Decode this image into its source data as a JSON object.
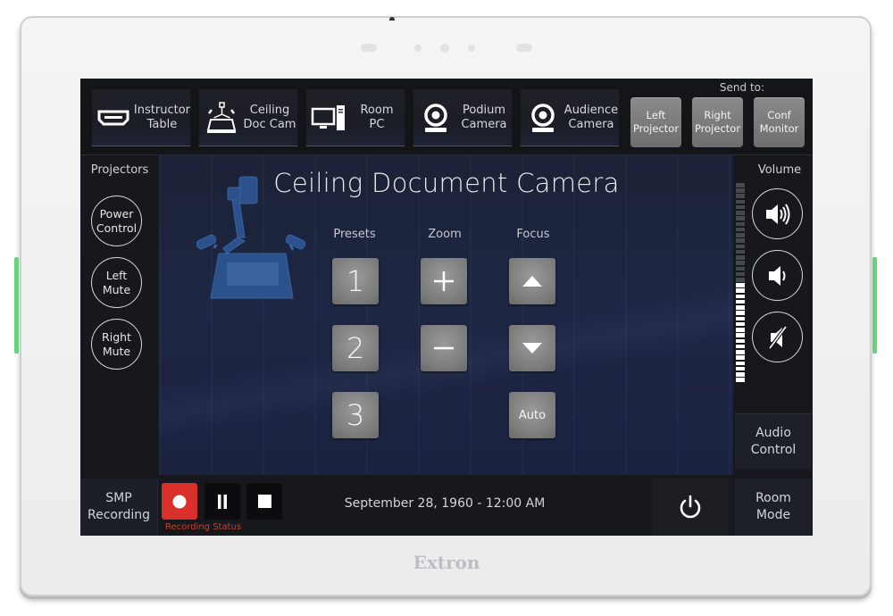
{
  "device": {
    "brand": "Extron",
    "indicator_color": "#64d37a"
  },
  "sources": [
    {
      "label": "Instructor\nTable",
      "icon": "hdmi-icon"
    },
    {
      "label": "Ceiling\nDoc Cam",
      "icon": "document-camera-icon"
    },
    {
      "label": "Room\nPC",
      "icon": "desktop-pc-icon"
    },
    {
      "label": "Podium\nCamera",
      "icon": "webcam-icon"
    },
    {
      "label": "Audience\nCamera",
      "icon": "webcam-icon"
    }
  ],
  "send_to": {
    "label": "Send to:",
    "destinations": [
      {
        "label": "Left\nProjector"
      },
      {
        "label": "Right\nProjector"
      },
      {
        "label": "Conf\nMonitor"
      }
    ]
  },
  "projectors": {
    "title": "Projectors",
    "buttons": [
      {
        "label": "Power\nControl"
      },
      {
        "label": "Left\nMute"
      },
      {
        "label": "Right\nMute"
      }
    ]
  },
  "main": {
    "title": "Ceiling Document Camera",
    "columns": {
      "presets": "Presets",
      "zoom": "Zoom",
      "focus": "Focus"
    },
    "presets": [
      "1",
      "2",
      "3"
    ],
    "zoom_in_icon": "plus-icon",
    "zoom_out_icon": "minus-icon",
    "focus_up_icon": "triangle-up-icon",
    "focus_down_icon": "triangle-down-icon",
    "focus_auto": "Auto"
  },
  "volume": {
    "title": "Volume",
    "level": 0.5,
    "segments": 36,
    "buttons": [
      "volume-up-icon",
      "volume-down-icon",
      "mute-icon"
    ]
  },
  "audio_control": {
    "label": "Audio\nControl"
  },
  "recording": {
    "section_label": "SMP\nRecording",
    "status_label": "Recording Status",
    "record_color": "#d9302c",
    "status_color": "#c2432c"
  },
  "datetime": "September 28, 1960 - 12:00 AM",
  "room_mode": {
    "label": "Room\nMode"
  }
}
